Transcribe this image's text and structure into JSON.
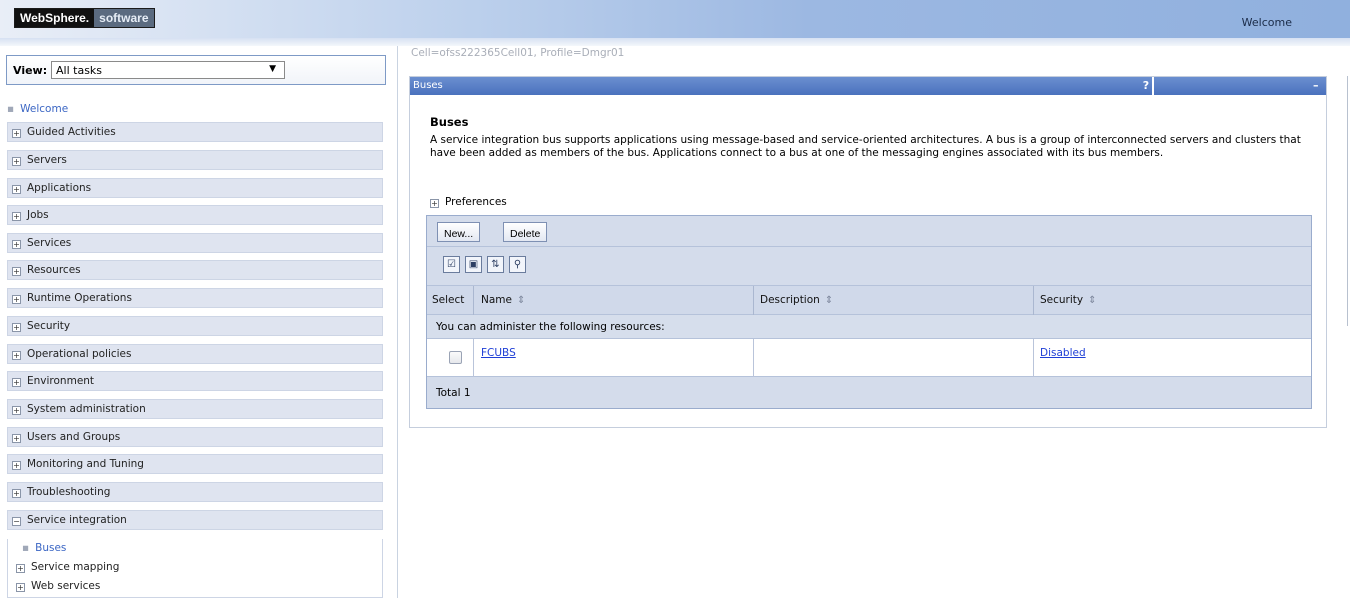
{
  "banner": {
    "brand": "WebSphere.",
    "brand_suffix": "software",
    "welcome": "Welcome"
  },
  "nav": {
    "view_label": "View:",
    "view_value": "All tasks",
    "welcome_link": "Welcome",
    "items": [
      {
        "label": "Guided Activities",
        "expanded": false
      },
      {
        "label": "Servers",
        "expanded": false
      },
      {
        "label": "Applications",
        "expanded": false
      },
      {
        "label": "Jobs",
        "expanded": false
      },
      {
        "label": "Services",
        "expanded": false
      },
      {
        "label": "Resources",
        "expanded": false
      },
      {
        "label": "Runtime Operations",
        "expanded": false
      },
      {
        "label": "Security",
        "expanded": false
      },
      {
        "label": "Operational policies",
        "expanded": false
      },
      {
        "label": "Environment",
        "expanded": false
      },
      {
        "label": "System administration",
        "expanded": false
      },
      {
        "label": "Users and Groups",
        "expanded": false
      },
      {
        "label": "Monitoring and Tuning",
        "expanded": false
      },
      {
        "label": "Troubleshooting",
        "expanded": false
      },
      {
        "label": "Service integration",
        "expanded": true
      }
    ],
    "service_integration_children": [
      {
        "label": "Buses"
      },
      {
        "label": "Service mapping"
      },
      {
        "label": "Web services"
      }
    ]
  },
  "main": {
    "breadcrumb": "Cell=ofss222365Cell01, Profile=Dmgr01",
    "portlet_title": "Buses",
    "help": "?",
    "minimize": "–",
    "heading": "Buses",
    "description": "A service integration bus supports applications using message-based and service-oriented architectures. A bus is a group of interconnected servers and clusters that have been added as members of the bus. Applications connect to a bus at one of the messaging engines associated with its bus members.",
    "preferences": "Preferences",
    "buttons": {
      "new": "New...",
      "delete": "Delete"
    },
    "columns": {
      "select": "Select",
      "name": "Name",
      "description": "Description",
      "security": "Security"
    },
    "message": "You can administer the following resources:",
    "rows": [
      {
        "name": "FCUBS",
        "description": "",
        "security": "Disabled",
        "selected": false
      }
    ],
    "total": "Total 1"
  },
  "icons": [
    "select-all-icon",
    "deselect-all-icon",
    "show-filter-icon",
    "clear-filter-icon",
    "plus-minus-icon",
    "sort-icon"
  ]
}
